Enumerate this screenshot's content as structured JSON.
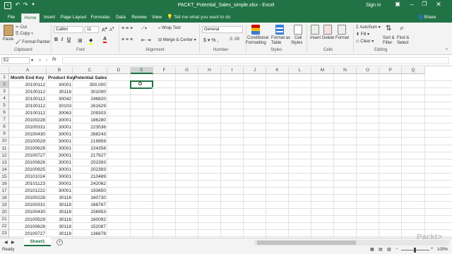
{
  "window": {
    "title": "PACKT_Potential_Sales_simple.xlsx - Excel",
    "signin": "Sign in"
  },
  "tabs": [
    "File",
    "Home",
    "Insert",
    "Page Layout",
    "Formulas",
    "Data",
    "Review",
    "View"
  ],
  "tellme": "Tell me what you want to do",
  "share": "Share",
  "ribbon": {
    "clipboard": {
      "paste": "Paste",
      "cut": "Cut",
      "copy": "Copy",
      "format_painter": "Format Painter",
      "label": "Clipboard"
    },
    "font": {
      "name": "Calibri",
      "size": "11",
      "label": "Font"
    },
    "alignment": {
      "wrap": "Wrap Text",
      "merge": "Merge & Center",
      "label": "Alignment"
    },
    "number": {
      "format": "General",
      "label": "Number"
    },
    "styles": {
      "cond1": "Conditional",
      "cond2": "Formatting",
      "fmt1": "Format as",
      "fmt2": "Table",
      "cell1": "Cell",
      "cell2": "Styles",
      "label": "Styles"
    },
    "cells": {
      "insert": "Insert",
      "delete": "Delete",
      "format": "Format",
      "label": "Cells"
    },
    "editing": {
      "autosum": "AutoSum",
      "fill": "Fill",
      "clear": "Clear",
      "sort1": "Sort &",
      "sort2": "Filter",
      "find1": "Find &",
      "find2": "Select",
      "label": "Editing"
    }
  },
  "formula_bar": {
    "name_box": "E2",
    "fx": "fx"
  },
  "columns": [
    "A",
    "B",
    "C",
    "D",
    "E",
    "F",
    "G",
    "H",
    "I",
    "J",
    "K",
    "L",
    "M",
    "N",
    "O",
    "P",
    "Q"
  ],
  "headers": [
    "Month End Key",
    "Product Key",
    "Potential Sales"
  ],
  "rows": [
    [
      "20100112",
      "30001",
      "350,000"
    ],
    [
      "20100112",
      "30118",
      "301000"
    ],
    [
      "20100112",
      "30042",
      "246820"
    ],
    [
      "20100112",
      "30103",
      "261629"
    ],
    [
      "20100112",
      "30063",
      "209303"
    ],
    [
      "20100228",
      "30001",
      "186280"
    ],
    [
      "20100331",
      "30001",
      "223536"
    ],
    [
      "20100430",
      "30001",
      "268243"
    ],
    [
      "20100529",
      "30001",
      "219959"
    ],
    [
      "20100628",
      "30001",
      "224358"
    ],
    [
      "20100727",
      "30001",
      "217627"
    ],
    [
      "20100826",
      "30001",
      "202393"
    ],
    [
      "20100925",
      "30001",
      "202393"
    ],
    [
      "20101024",
      "30001",
      "210489"
    ],
    [
      "20101123",
      "30001",
      "242062"
    ],
    [
      "20101222",
      "30001",
      "193650"
    ],
    [
      "20100228",
      "30118",
      "160730"
    ],
    [
      "20100331",
      "30118",
      "168767"
    ],
    [
      "20100430",
      "30118",
      "156953"
    ],
    [
      "20100529",
      "30118",
      "160092"
    ],
    [
      "20100628",
      "30118",
      "152087"
    ],
    [
      "20100727",
      "30118",
      "136878"
    ],
    [
      "20100826",
      "30118",
      "164254"
    ]
  ],
  "row_numbers": [
    "1",
    "2",
    "3",
    "4",
    "5",
    "6",
    "7",
    "8",
    "9",
    "10",
    "11",
    "12",
    "13",
    "14",
    "15",
    "16",
    "17",
    "18",
    "19",
    "20",
    "21",
    "22",
    "23",
    "24"
  ],
  "sheet_tab": "Sheet1",
  "status": {
    "ready": "Ready",
    "zoom": "100%"
  },
  "watermark": "Packt>",
  "colors": {
    "excel_green": "#217346"
  }
}
